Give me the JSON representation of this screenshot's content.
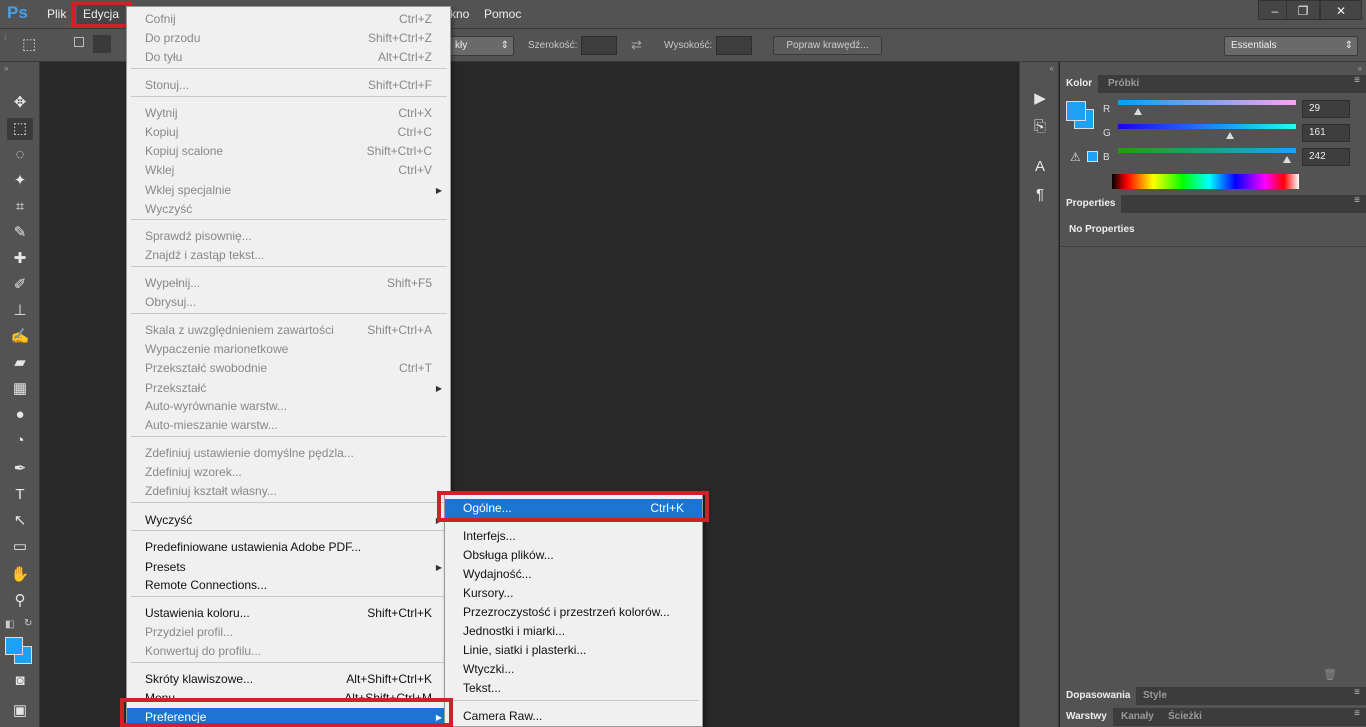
{
  "app": {
    "logo": "Ps"
  },
  "menubar": {
    "items": [
      {
        "label": "Plik"
      },
      {
        "label": "Edycja"
      },
      {
        "label": "kno"
      },
      {
        "label": "Pomoc"
      }
    ],
    "window_buttons": [
      "–",
      "❐",
      "✕"
    ]
  },
  "options": {
    "style_value": "kły",
    "width_label": "Szerokość:",
    "height_label": "Wysokość:",
    "refine_label": "Popraw krawędź...",
    "workspace": "Essentials"
  },
  "edit_menu": {
    "items": [
      {
        "label": "Cofnij",
        "shortcut": "Ctrl+Z",
        "enabled": false
      },
      {
        "label": "Do przodu",
        "shortcut": "Shift+Ctrl+Z",
        "enabled": false
      },
      {
        "label": "Do tyłu",
        "shortcut": "Alt+Ctrl+Z",
        "enabled": false
      },
      {
        "label": "Stonuj...",
        "shortcut": "Shift+Ctrl+F",
        "enabled": false
      },
      {
        "label": "Wytnij",
        "shortcut": "Ctrl+X",
        "enabled": false
      },
      {
        "label": "Kopiuj",
        "shortcut": "Ctrl+C",
        "enabled": false
      },
      {
        "label": "Kopiuj scalone",
        "shortcut": "Shift+Ctrl+C",
        "enabled": false
      },
      {
        "label": "Wklej",
        "shortcut": "Ctrl+V",
        "enabled": false
      },
      {
        "label": "Wklej specjalnie",
        "shortcut": "",
        "enabled": false
      },
      {
        "label": "Wyczyść",
        "shortcut": "",
        "enabled": false
      },
      {
        "label": "Sprawdź pisownię...",
        "shortcut": "",
        "enabled": false
      },
      {
        "label": "Znajdź i zastąp tekst...",
        "shortcut": "",
        "enabled": false
      },
      {
        "label": "Wypełnij...",
        "shortcut": "Shift+F5",
        "enabled": false
      },
      {
        "label": "Obrysuj...",
        "shortcut": "",
        "enabled": false
      },
      {
        "label": "Skala z uwzględnieniem zawartości",
        "shortcut": "Shift+Ctrl+A",
        "enabled": false
      },
      {
        "label": "Wypaczenie marionetkowe",
        "shortcut": "",
        "enabled": false
      },
      {
        "label": "Przekształć swobodnie",
        "shortcut": "Ctrl+T",
        "enabled": false
      },
      {
        "label": "Przekształć",
        "shortcut": "",
        "enabled": false
      },
      {
        "label": "Auto-wyrównanie warstw...",
        "shortcut": "",
        "enabled": false
      },
      {
        "label": "Auto-mieszanie warstw...",
        "shortcut": "",
        "enabled": false
      },
      {
        "label": "Zdefiniuj ustawienie domyślne pędzla...",
        "shortcut": "",
        "enabled": false
      },
      {
        "label": "Zdefiniuj wzorek...",
        "shortcut": "",
        "enabled": false
      },
      {
        "label": "Zdefiniuj kształt własny...",
        "shortcut": "",
        "enabled": false
      },
      {
        "label": "Wyczyść",
        "shortcut": "",
        "enabled": true
      },
      {
        "label": "Predefiniowane ustawienia Adobe PDF...",
        "shortcut": "",
        "enabled": true
      },
      {
        "label": "Presets",
        "shortcut": "",
        "enabled": true
      },
      {
        "label": "Remote Connections...",
        "shortcut": "",
        "enabled": true
      },
      {
        "label": "Ustawienia koloru...",
        "shortcut": "Shift+Ctrl+K",
        "enabled": true
      },
      {
        "label": "Przydziel profil...",
        "shortcut": "",
        "enabled": false
      },
      {
        "label": "Konwertuj do profilu...",
        "shortcut": "",
        "enabled": false
      },
      {
        "label": "Skróty klawiszowe...",
        "shortcut": "Alt+Shift+Ctrl+K",
        "enabled": true
      },
      {
        "label": "Menu...",
        "shortcut": "Alt+Shift+Ctrl+M",
        "enabled": true
      },
      {
        "label": "Preferencje",
        "shortcut": "",
        "enabled": true
      }
    ]
  },
  "prefs_menu": {
    "items": [
      {
        "label": "Ogólne...",
        "shortcut": "Ctrl+K"
      },
      {
        "label": "Interfejs..."
      },
      {
        "label": "Obsługa plików..."
      },
      {
        "label": "Wydajność..."
      },
      {
        "label": "Kursory..."
      },
      {
        "label": "Przezroczystość i przestrzeń kolorów..."
      },
      {
        "label": "Jednostki i miarki..."
      },
      {
        "label": "Linie, siatki i plasterki..."
      },
      {
        "label": "Wtyczki..."
      },
      {
        "label": "Tekst..."
      },
      {
        "label": "Camera Raw..."
      }
    ]
  },
  "color_panel": {
    "tabs": [
      "Kolor",
      "Próbki"
    ],
    "channels": [
      {
        "name": "R",
        "value": "29",
        "fraction": 0.114
      },
      {
        "name": "G",
        "value": "161",
        "fraction": 0.631
      },
      {
        "name": "B",
        "value": "242",
        "fraction": 0.949
      }
    ],
    "foreground": "#1da1f2"
  },
  "properties_panel": {
    "tab": "Properties",
    "empty_text": "No Properties"
  },
  "bottom_tabs": {
    "group1": [
      "Dopasowania",
      "Style"
    ],
    "group2": [
      "Warstwy",
      "Kanały",
      "Ścieżki"
    ]
  },
  "accent": "#1a76d2",
  "highlight_red": "#d0202a"
}
